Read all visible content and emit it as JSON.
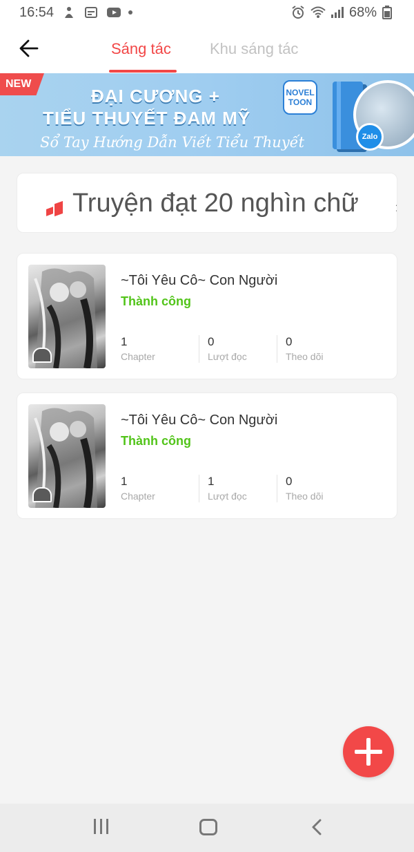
{
  "status_bar": {
    "time": "16:54",
    "battery": "68%"
  },
  "header": {
    "tabs": [
      {
        "label": "Sáng tác",
        "active": true
      },
      {
        "label": "Khu sáng tác",
        "active": false
      }
    ],
    "accent_color": "#f24747"
  },
  "banner": {
    "badge": "NEW",
    "line1": "ĐẠI CƯƠNG +",
    "line2": "TIỂU THUYẾT ĐAM MỸ",
    "line3": "Sổ Tay Hướng Dẫn Viết Tiểu Thuyết",
    "logo_top": "NOVEL",
    "logo_bottom": "TOON",
    "zalo": "Zalo"
  },
  "milestone": {
    "text": "Truyện đạt 20 nghìn chữ",
    "chevron": "›"
  },
  "stories": [
    {
      "title": "~Tôi Yêu Cô~ Con Người",
      "status": "Thành công",
      "stats": [
        {
          "value": "1",
          "label": "Chapter"
        },
        {
          "value": "0",
          "label": "Lượt đọc"
        },
        {
          "value": "0",
          "label": "Theo dõi"
        }
      ]
    },
    {
      "title": "~Tôi Yêu Cô~ Con Người",
      "status": "Thành công",
      "stats": [
        {
          "value": "1",
          "label": "Chapter"
        },
        {
          "value": "1",
          "label": "Lượt đọc"
        },
        {
          "value": "0",
          "label": "Theo dõi"
        }
      ]
    }
  ],
  "status_color": "#52c41a",
  "fab_icon": "plus-icon",
  "nav_icons": [
    "recents-icon",
    "home-icon",
    "back-icon"
  ]
}
